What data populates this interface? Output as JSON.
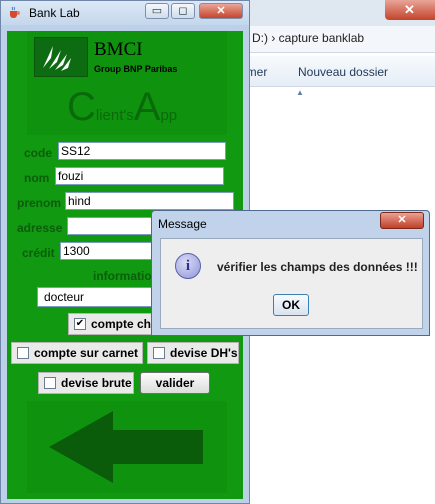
{
  "background_window": {
    "address_text": "D:) › capture banklab",
    "toolbar_item_1": "imer",
    "toolbar_item_2": "Nouveau dossier",
    "close_glyph": "✕"
  },
  "window": {
    "title": "Bank Lab",
    "minimize_glyph": "▭",
    "maximize_glyph": "◻",
    "close_glyph": "✕"
  },
  "logo": {
    "name": "BMCI",
    "subtitle": "Group BNP Paribas",
    "app_c": "C",
    "app_lients": "lient's",
    "app_a": "A",
    "app_pp": "pp"
  },
  "form": {
    "code_label": "code",
    "code_value": "SS12",
    "nom_label": "nom",
    "nom_value": "fouzi",
    "prenom_label": "prenom",
    "prenom_value": "hind",
    "adresse_label": "adresse",
    "adresse_value": "",
    "credit_label": "crédit",
    "credit_value": "1300",
    "information_label": "information",
    "profession_value": "docteur",
    "compte_cheque_label": "compte ch",
    "compte_cheque_checked": "✔",
    "compte_carnet_label": "compte sur carnet",
    "devise_dh_label": "devise DH's",
    "devise_brute_label": "devise brute",
    "valider_label": "valider"
  },
  "dialog": {
    "title": "Message",
    "close_glyph": "✕",
    "icon_glyph": "i",
    "message": "vérifier les champs des données !!!",
    "ok_label": "OK"
  },
  "colors": {
    "panel_green": "#119911",
    "dark_green": "#0a5e0a",
    "arrow_green": "#0a5c0a"
  }
}
